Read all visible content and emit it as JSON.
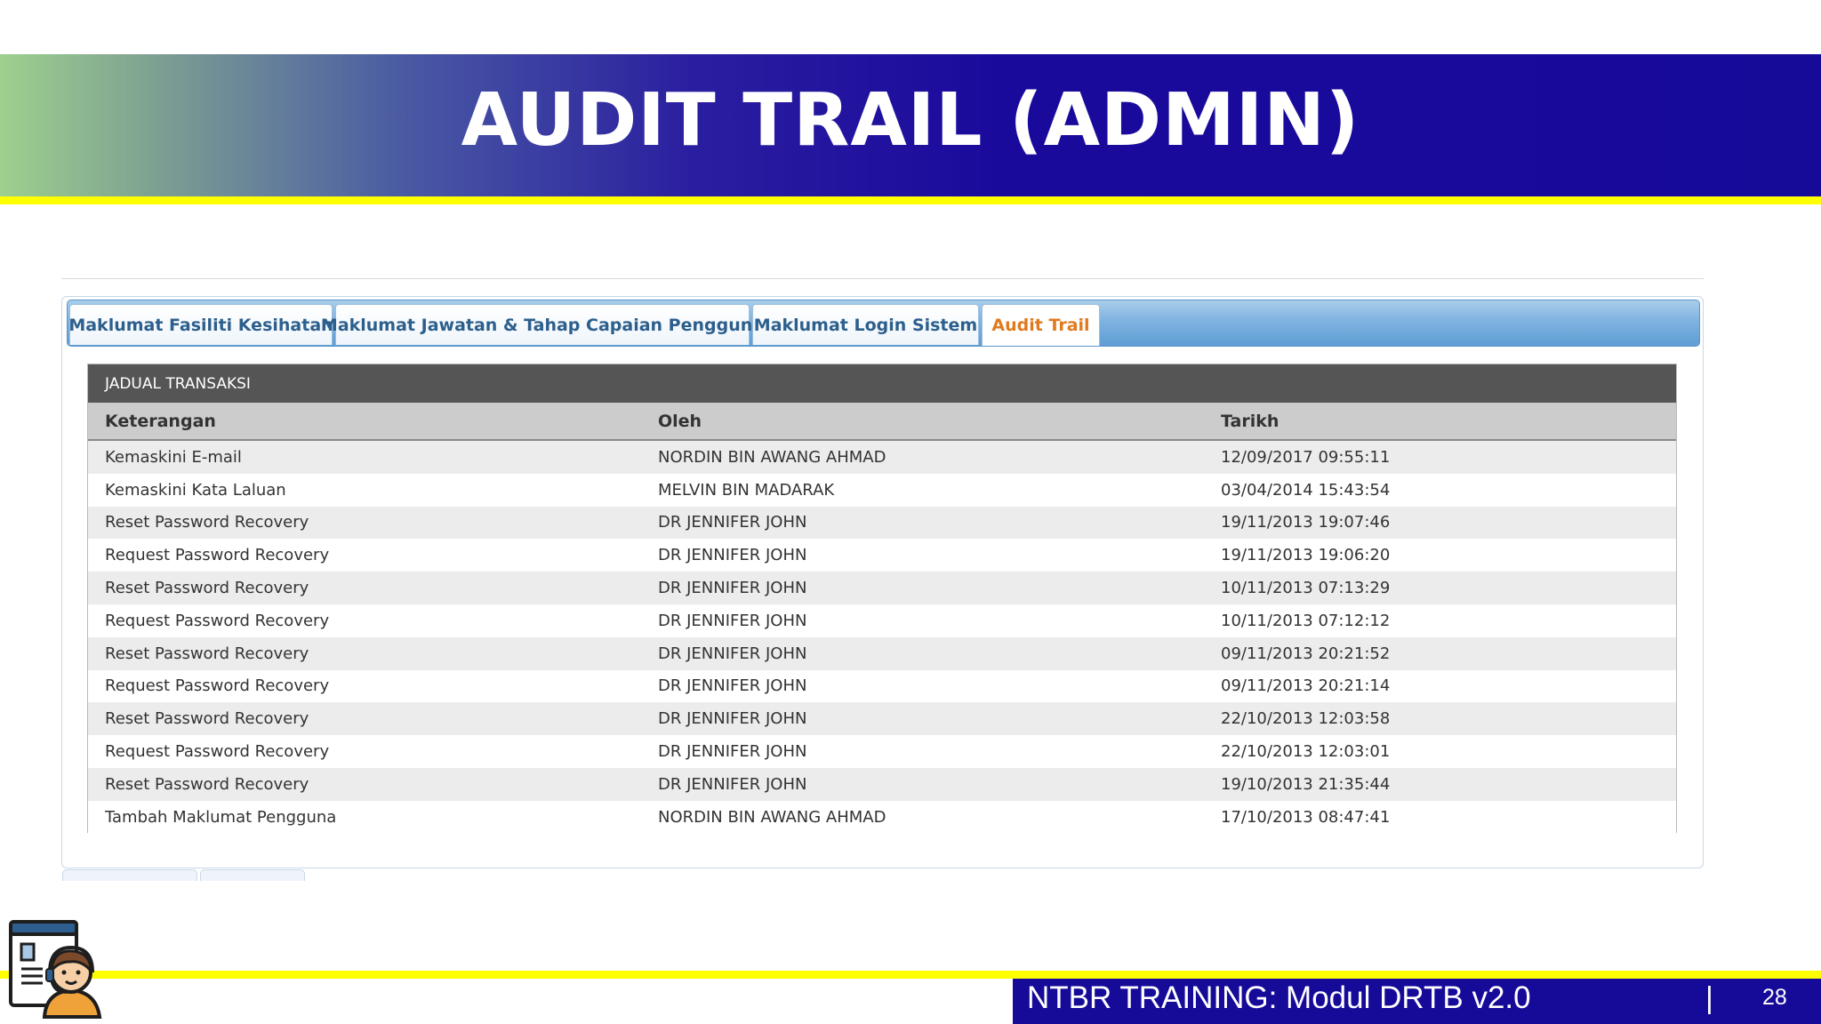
{
  "slide": {
    "title": "AUDIT TRAIL (ADMIN)",
    "footer_text": "NTBR TRAINING: Modul DRTB v2.0",
    "footer_separator": "|",
    "page_number": "28"
  },
  "tabs": [
    {
      "label": "Maklumat Fasiliti Kesihatan",
      "active": false
    },
    {
      "label": "Maklumat Jawatan & Tahap Capaian Pengguna",
      "active": false
    },
    {
      "label": "Maklumat Login Sistem",
      "active": false
    },
    {
      "label": "Audit Trail",
      "active": true
    }
  ],
  "table": {
    "caption": "JADUAL TRANSAKSI",
    "columns": [
      "Keterangan",
      "Oleh",
      "Tarikh"
    ],
    "rows": [
      [
        "Kemaskini E-mail",
        "NORDIN BIN AWANG AHMAD",
        "12/09/2017 09:55:11"
      ],
      [
        "Kemaskini Kata Laluan",
        "MELVIN BIN MADARAK",
        "03/04/2014 15:43:54"
      ],
      [
        "Reset Password Recovery",
        "DR JENNIFER JOHN",
        "19/11/2013 19:07:46"
      ],
      [
        "Request Password Recovery",
        "DR JENNIFER JOHN",
        "19/11/2013 19:06:20"
      ],
      [
        "Reset Password Recovery",
        "DR JENNIFER JOHN",
        "10/11/2013 07:13:29"
      ],
      [
        "Request Password Recovery",
        "DR JENNIFER JOHN",
        "10/11/2013 07:12:12"
      ],
      [
        "Reset Password Recovery",
        "DR JENNIFER JOHN",
        "09/11/2013 20:21:52"
      ],
      [
        "Request Password Recovery",
        "DR JENNIFER JOHN",
        "09/11/2013 20:21:14"
      ],
      [
        "Reset Password Recovery",
        "DR JENNIFER JOHN",
        "22/10/2013 12:03:58"
      ],
      [
        "Request Password Recovery",
        "DR JENNIFER JOHN",
        "22/10/2013 12:03:01"
      ],
      [
        "Reset Password Recovery",
        "DR JENNIFER JOHN",
        "19/10/2013 21:35:44"
      ],
      [
        "Tambah Maklumat Pengguna",
        "NORDIN BIN AWANG AHMAD",
        "17/10/2013 08:47:41"
      ]
    ]
  },
  "colors": {
    "banner_dark": "#160a99",
    "accent_yellow": "#ffff00",
    "active_tab_text": "#e07a1f",
    "tab_text": "#2d5f8c"
  },
  "icons": {
    "presenter": "support-agent-icon"
  }
}
